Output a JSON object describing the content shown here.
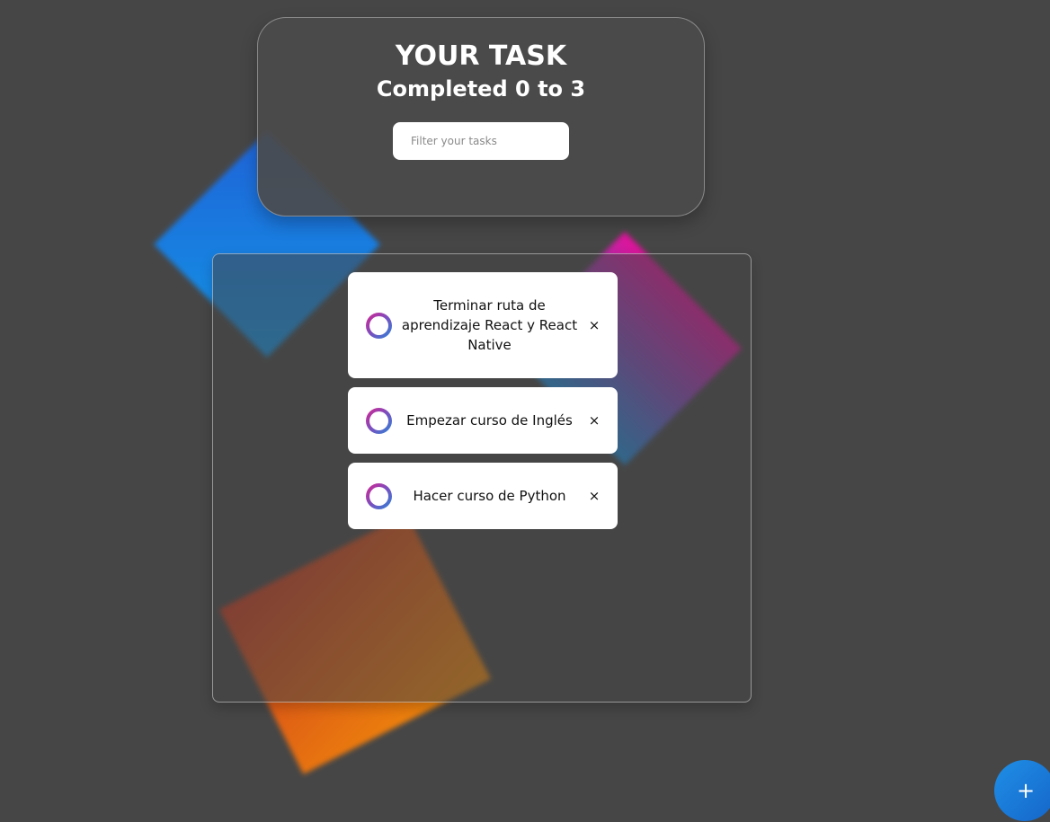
{
  "header": {
    "title": "YOUR TASK",
    "subtitle_prefix": "Completed",
    "completed_count": "0",
    "subtitle_mid": "to",
    "total_count": "3"
  },
  "search": {
    "placeholder": "Filter your tasks",
    "value": ""
  },
  "tasks": [
    {
      "text": "Terminar ruta de aprendizaje React y React Native",
      "completed": false,
      "delete_label": "×"
    },
    {
      "text": "Empezar curso de Inglés",
      "completed": false,
      "delete_label": "×"
    },
    {
      "text": "Hacer curso de Python",
      "completed": false,
      "delete_label": "×"
    }
  ],
  "fab": {
    "label": "+"
  },
  "colors": {
    "background": "#464646",
    "accent_blue": "#1f8fe6",
    "accent_pink": "#e0129a",
    "accent_orange": "#f08a0a"
  },
  "icons": {
    "check": "circle-check-icon",
    "delete": "close-icon",
    "add": "plus-icon"
  }
}
